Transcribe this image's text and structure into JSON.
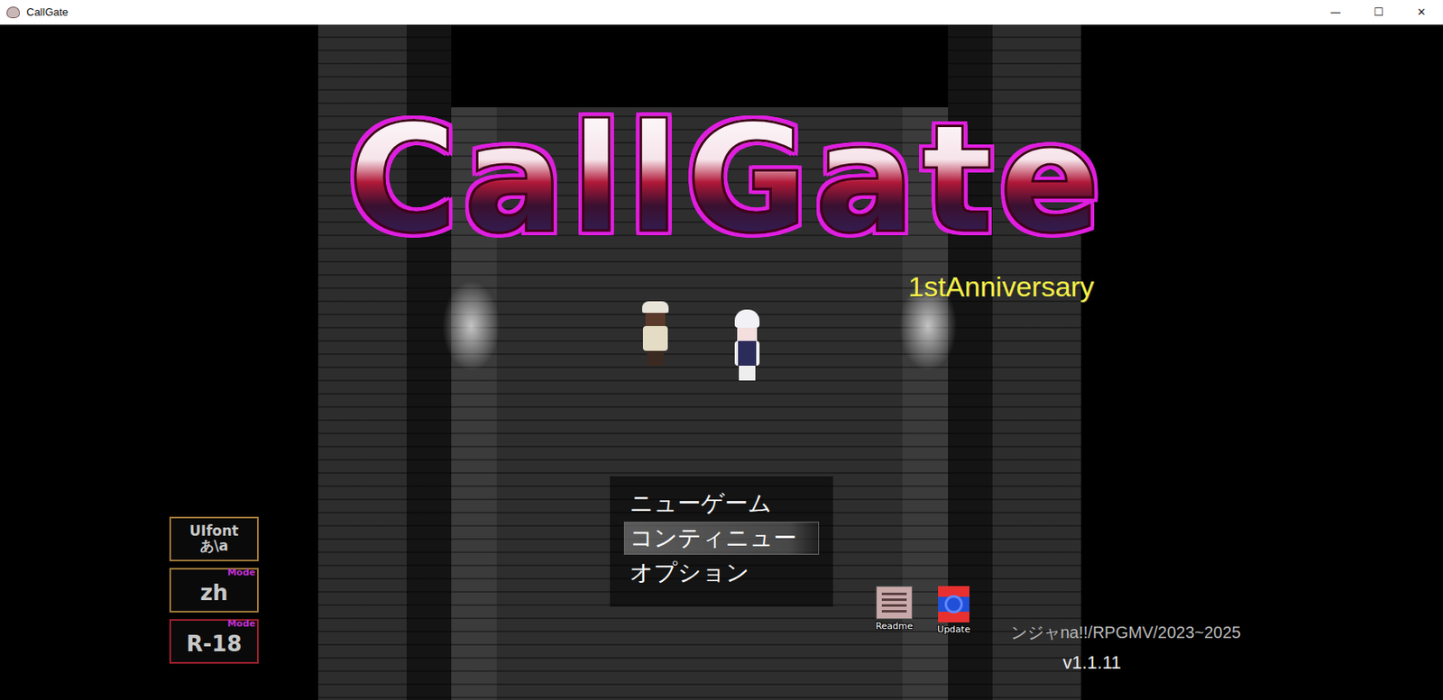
{
  "window": {
    "title": "CallGate",
    "controls": [
      "—",
      "☐",
      "✕"
    ]
  },
  "title_screen": {
    "logo": "CallGate",
    "subtitle": "1stAnniversary"
  },
  "menu": [
    {
      "label": "ニューゲーム",
      "selected": false
    },
    {
      "label": "コンティニュー",
      "selected": true
    },
    {
      "label": "オプション",
      "selected": false
    }
  ],
  "side_buttons": [
    {
      "lines": [
        "UIfont",
        "あ\\a"
      ],
      "color": "#a07a3a"
    },
    {
      "lines": [
        "zh"
      ],
      "badge": "Mode",
      "color": "#a07a3a"
    },
    {
      "lines": [
        "R-18"
      ],
      "badge": "Mode",
      "color": "#a02030"
    }
  ],
  "shortcuts": [
    {
      "label": "Readme",
      "kind": "readme"
    },
    {
      "label": "Update",
      "kind": "update"
    }
  ],
  "footer": {
    "credit": "ンジャna!!/RPGMV/2023~2025",
    "version": "v1.1.11"
  }
}
